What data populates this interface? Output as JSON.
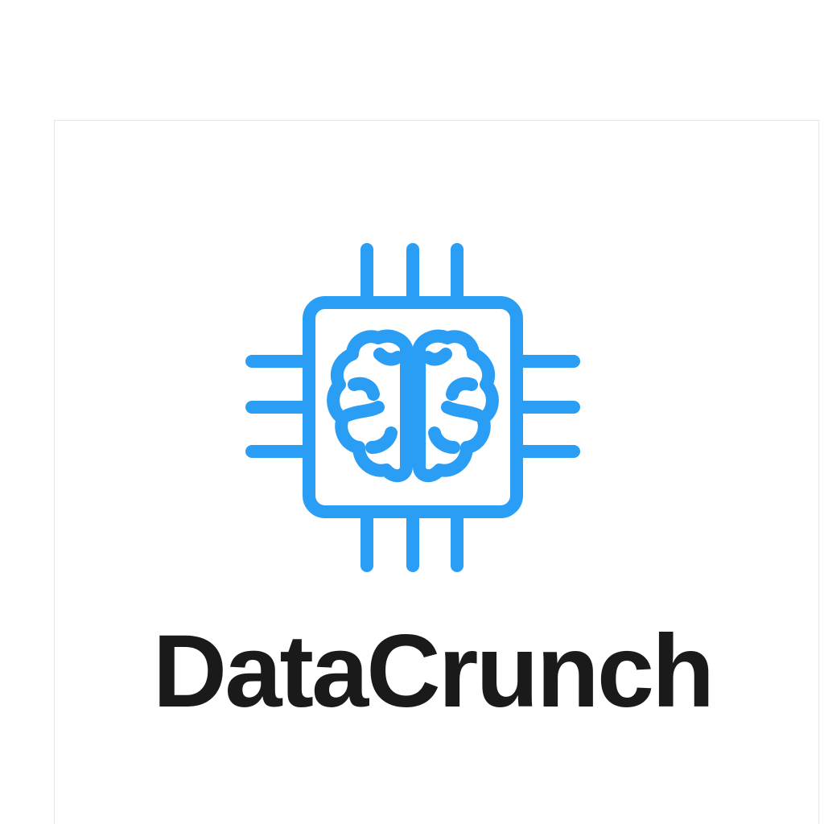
{
  "brand": {
    "name": "DataCrunch",
    "accent_color": "#2A9DF4",
    "text_color": "#1A1A1A"
  },
  "logo": {
    "icon": "chip-brain-icon"
  }
}
